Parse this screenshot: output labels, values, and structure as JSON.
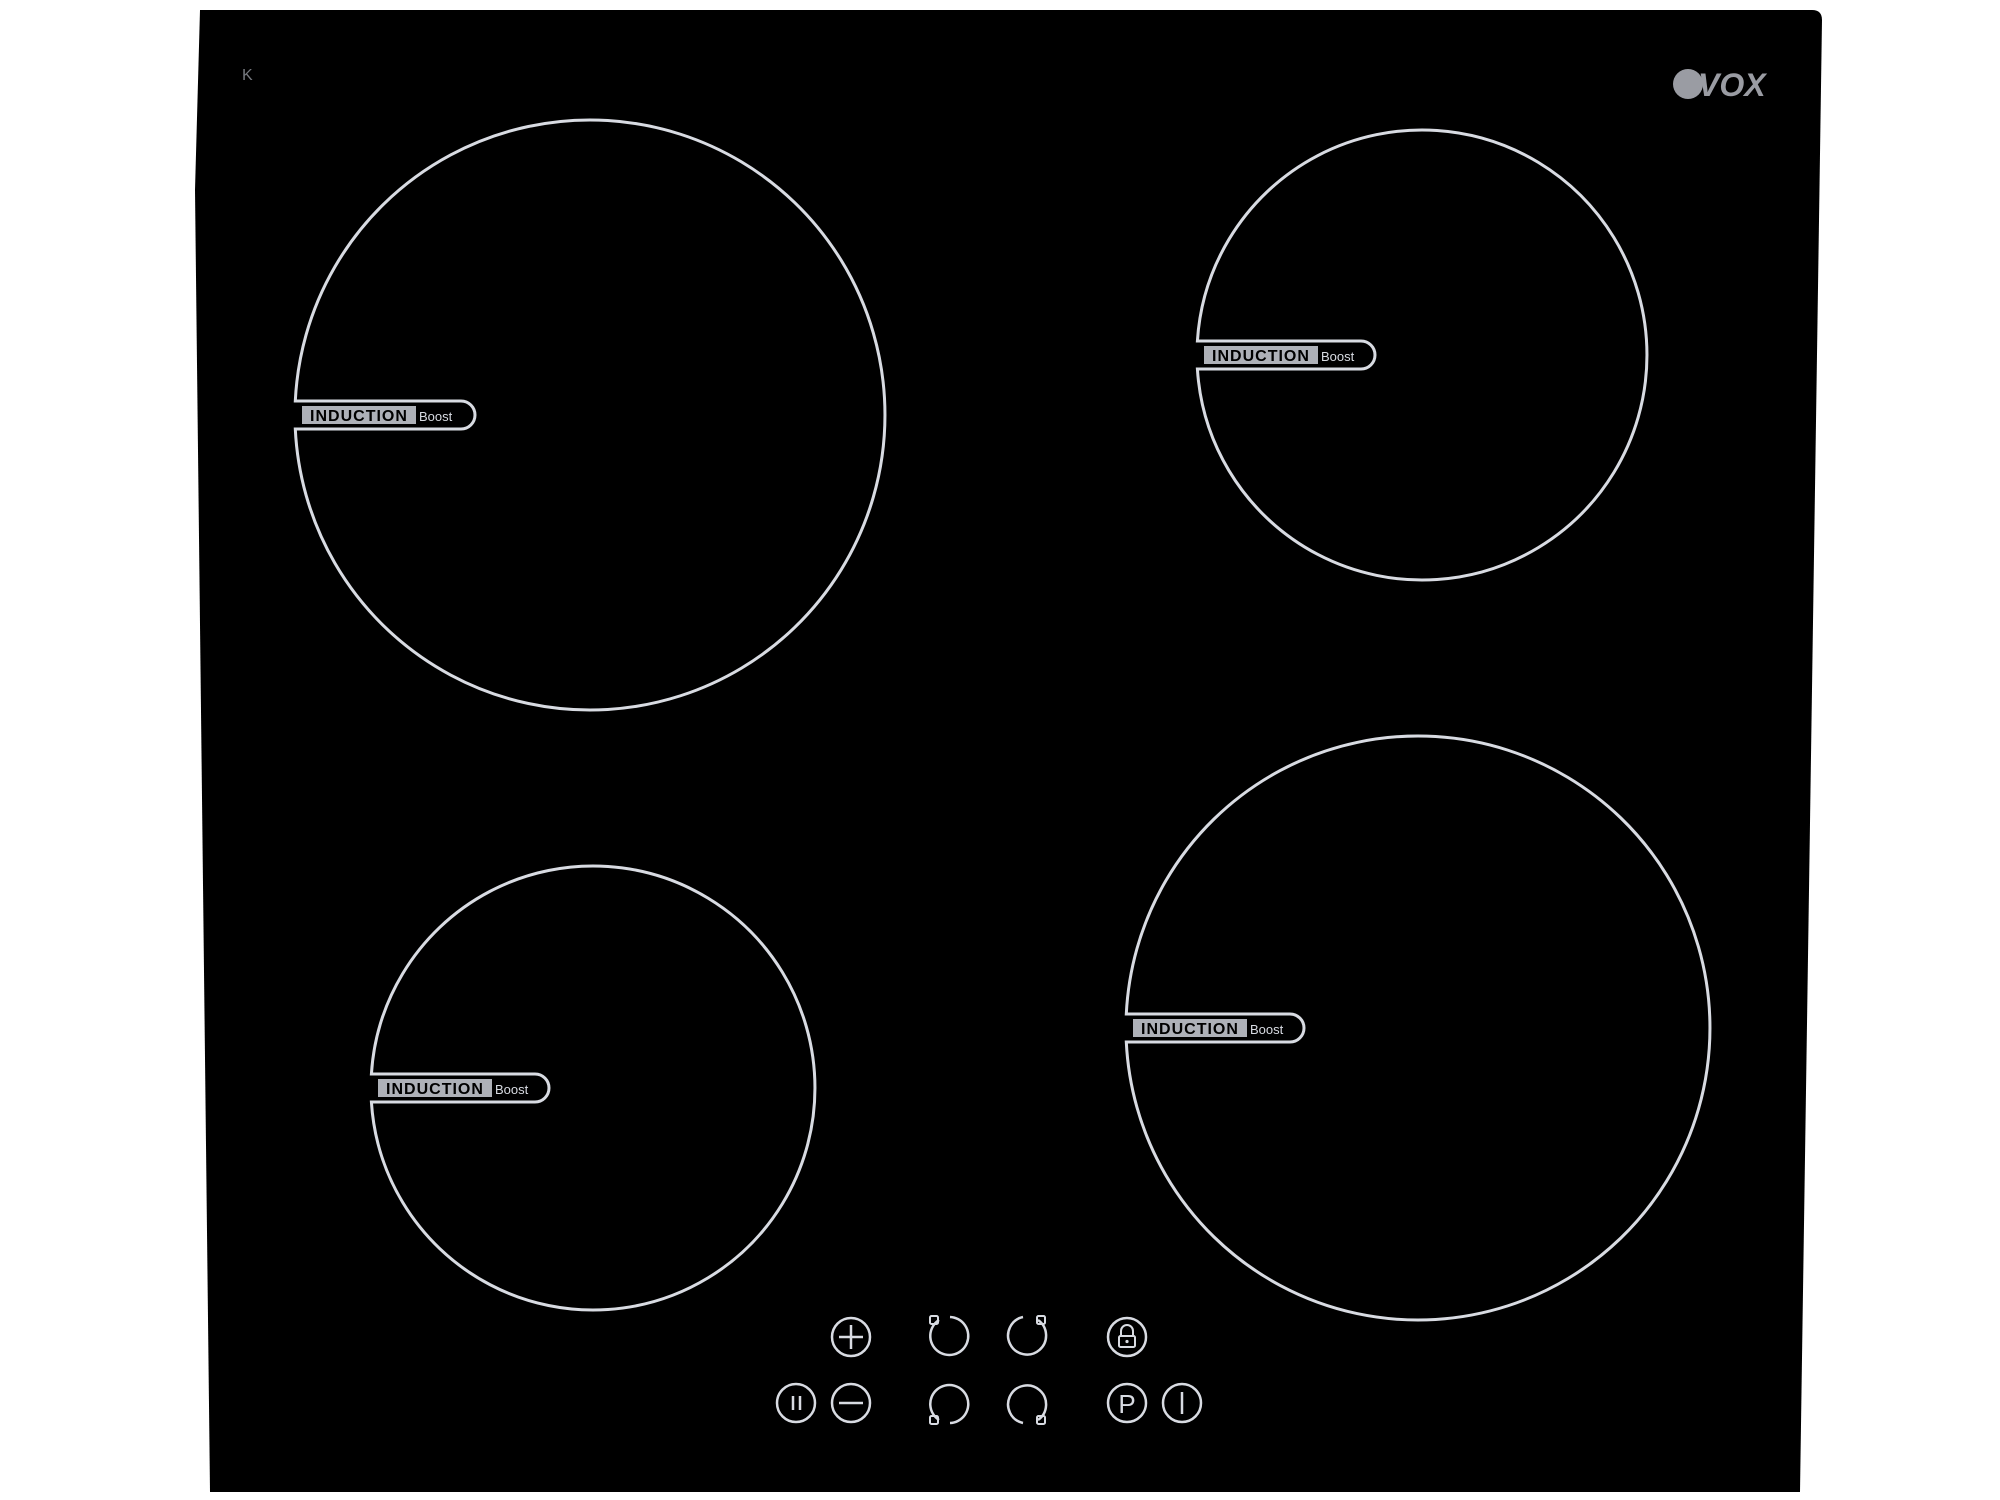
{
  "brand": {
    "name": "VOX",
    "logo_color": "#9a9ca3"
  },
  "corner_mark": "K",
  "colors": {
    "glass": "#000000",
    "ring": "#d8dbe2",
    "label_bg": "#aeb1b8"
  },
  "zones": [
    {
      "id": "rear-left",
      "label": "INDUCTION",
      "boost": "Boost"
    },
    {
      "id": "rear-right",
      "label": "INDUCTION",
      "boost": "Boost"
    },
    {
      "id": "front-left",
      "label": "INDUCTION",
      "boost": "Boost"
    },
    {
      "id": "front-right",
      "label": "INDUCTION",
      "boost": "Boost"
    }
  ],
  "controls": [
    {
      "id": "plus",
      "icon": "plus-icon"
    },
    {
      "id": "minus",
      "icon": "minus-icon"
    },
    {
      "id": "pause",
      "icon": "pause-icon"
    },
    {
      "id": "zone-select-rear-left",
      "icon": "zone-rear-left-icon"
    },
    {
      "id": "zone-select-rear-right",
      "icon": "zone-rear-right-icon"
    },
    {
      "id": "zone-select-front-left",
      "icon": "zone-front-left-icon"
    },
    {
      "id": "zone-select-front-right",
      "icon": "zone-front-right-icon"
    },
    {
      "id": "lock",
      "icon": "lock-icon"
    },
    {
      "id": "power-boost",
      "icon": "p-icon",
      "text": "P"
    },
    {
      "id": "power",
      "icon": "power-icon"
    }
  ]
}
